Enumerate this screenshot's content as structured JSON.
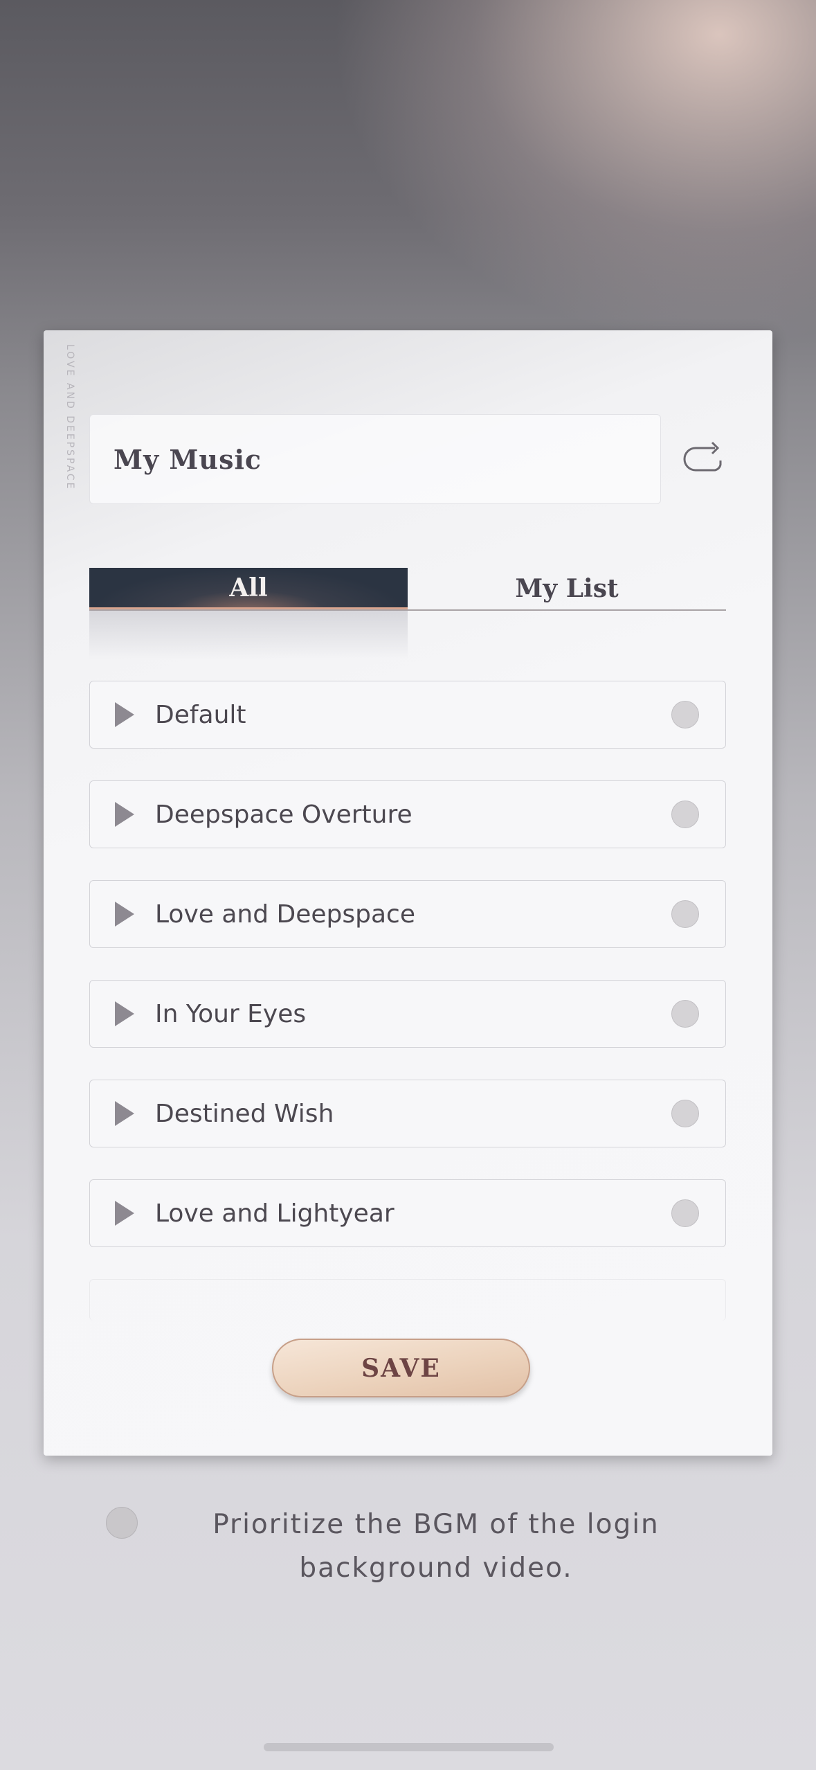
{
  "header": {
    "title": "My Music",
    "refresh_icon": "refresh-icon"
  },
  "tabs": [
    {
      "label": "All",
      "active": true
    },
    {
      "label": "My List",
      "active": false
    }
  ],
  "tracks": [
    {
      "label": "Default",
      "selected": false
    },
    {
      "label": "Deepspace Overture",
      "selected": false
    },
    {
      "label": "Love and Deepspace",
      "selected": false
    },
    {
      "label": "In Your Eyes",
      "selected": false
    },
    {
      "label": "Destined Wish",
      "selected": false
    },
    {
      "label": "Love and Lightyear",
      "selected": false
    }
  ],
  "save_label": "SAVE",
  "option": {
    "label": "Prioritize the BGM of the login background video.",
    "checked": false
  },
  "watermark": "LOVE AND DEEPSPACE",
  "colors": {
    "tab_active": "#2b3442",
    "save_button": "#ecd3bd",
    "text": "#4a4650"
  }
}
